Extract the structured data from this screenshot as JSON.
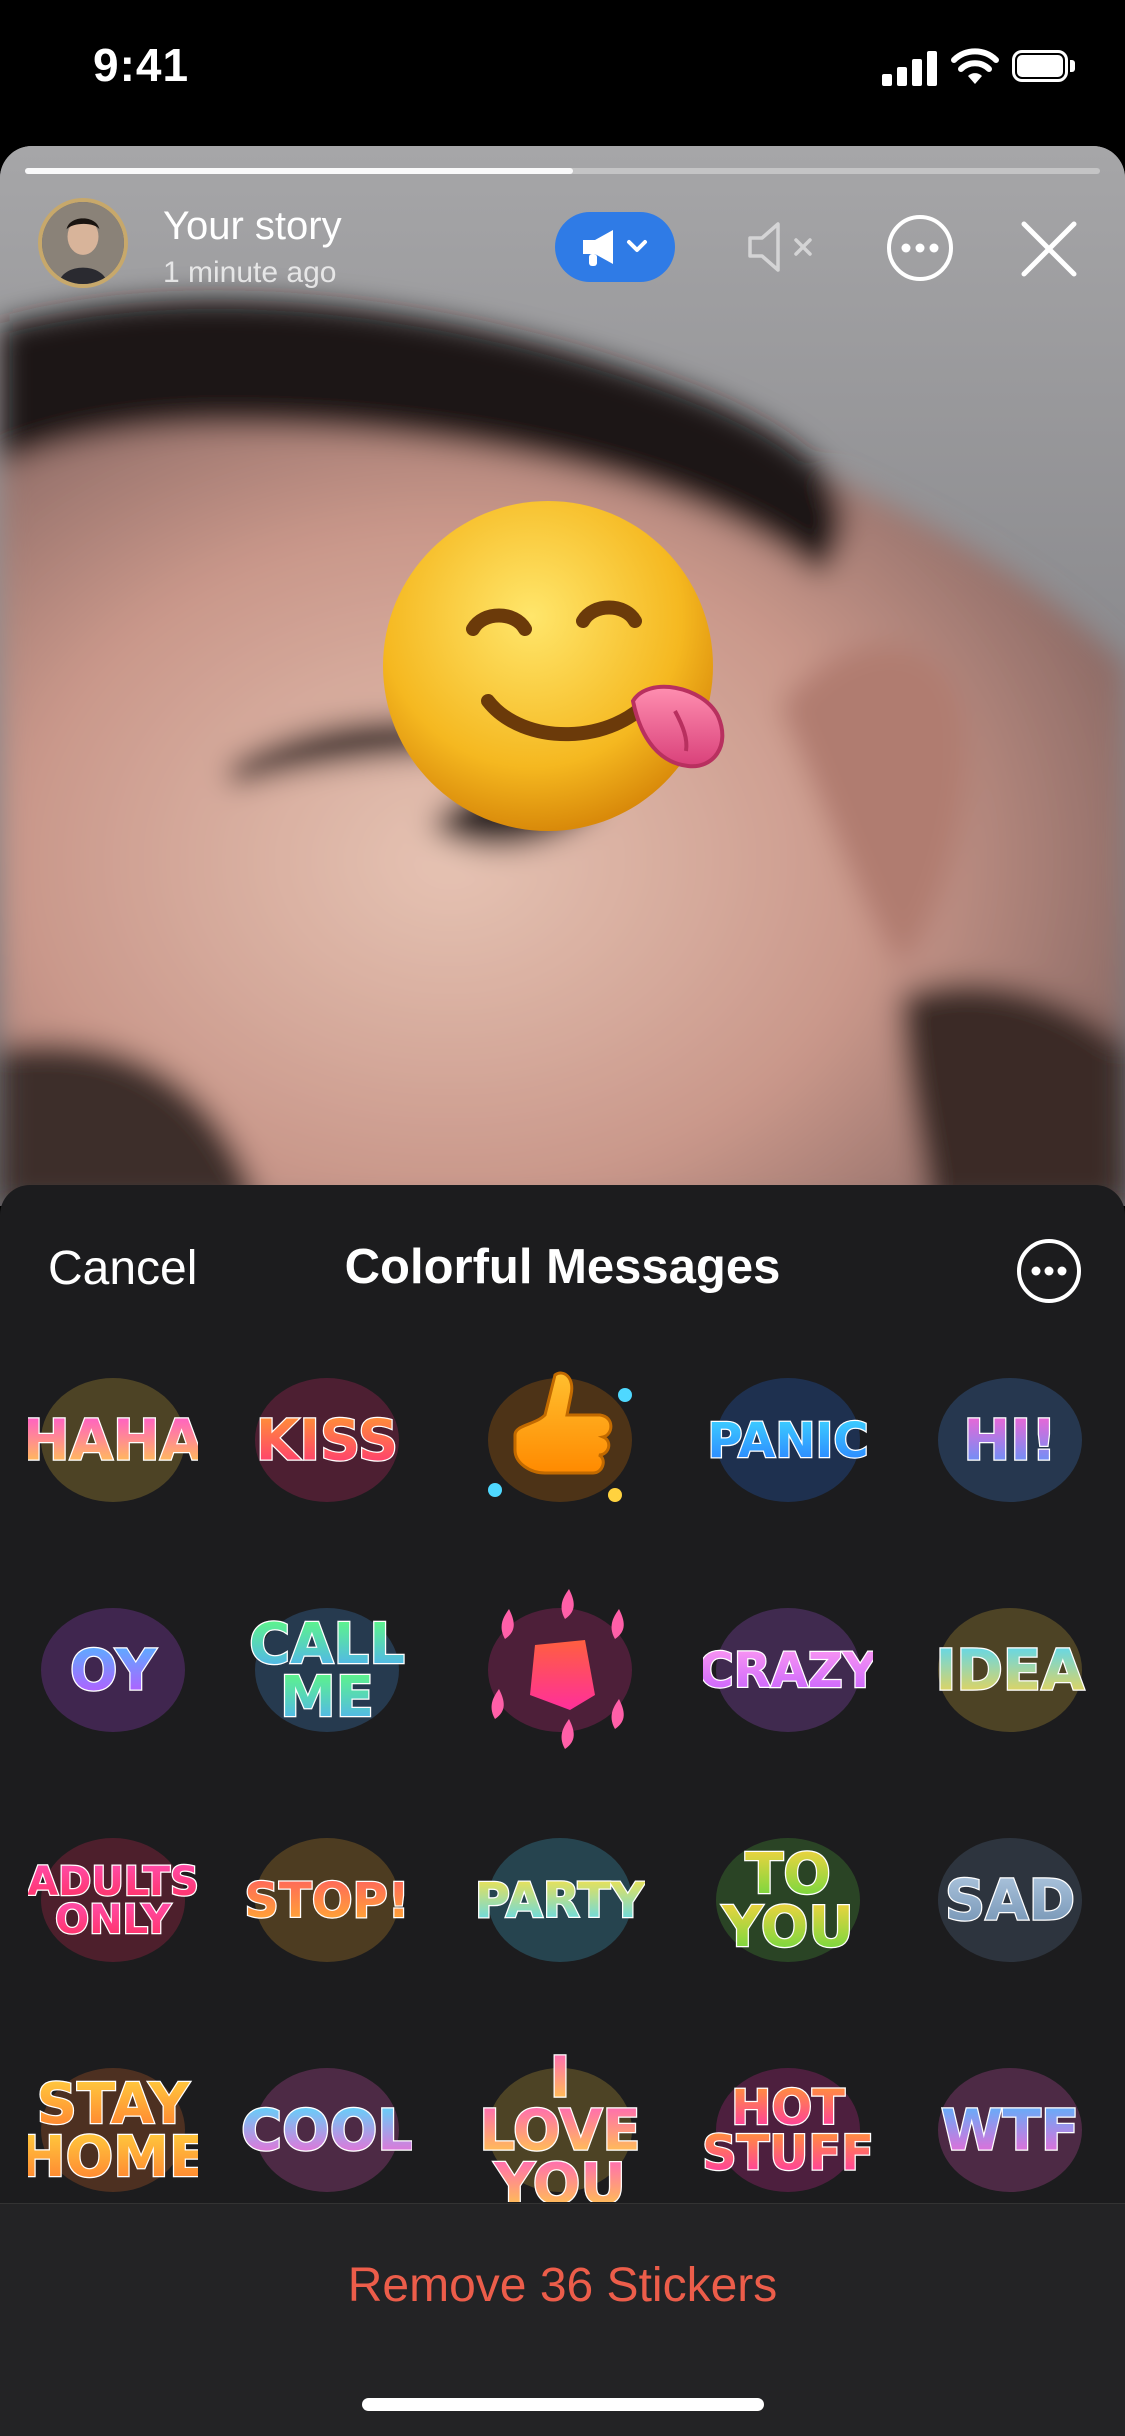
{
  "status_bar": {
    "time": "9:41"
  },
  "story": {
    "title": "Your story",
    "subtitle": "1 minute ago",
    "progress": 0.51,
    "sticker_emoji": "face-savoring-food"
  },
  "sheet": {
    "cancel_label": "Cancel",
    "title": "Colorful Messages",
    "more_icon": "ellipsis-circle-icon",
    "stickers": [
      {
        "text": "HAHA",
        "colors": [
          "#ff4fd8",
          "#ffd23f"
        ]
      },
      {
        "text": "KISS",
        "colors": [
          "#ff9b2f",
          "#ff2f7a"
        ]
      },
      {
        "text": "",
        "icon": "thumbs-up",
        "colors": [
          "#ffbf2f",
          "#ff8a00"
        ]
      },
      {
        "text": "PANIC",
        "colors": [
          "#3fd8ff",
          "#2a7cff"
        ]
      },
      {
        "text": "HI!",
        "colors": [
          "#ff5fd0",
          "#4f9bff"
        ]
      },
      {
        "text": "OY",
        "colors": [
          "#4fb8ff",
          "#c44fff"
        ]
      },
      {
        "text": "CALL ME",
        "colors": [
          "#5fff7a",
          "#4fa8ff"
        ]
      },
      {
        "text": "",
        "icon": "flame",
        "colors": [
          "#ff5f3f",
          "#ff2f9b"
        ]
      },
      {
        "text": "CRAZY",
        "colors": [
          "#ff9bf0",
          "#c45fff"
        ]
      },
      {
        "text": "IDEA",
        "colors": [
          "#4fd8ff",
          "#ffd23f"
        ]
      },
      {
        "text": "ADULTS ONLY",
        "colors": [
          "#ff4fb0",
          "#ff2f5f"
        ]
      },
      {
        "text": "STOP!",
        "colors": [
          "#ff5f5f",
          "#ffb02f"
        ]
      },
      {
        "text": "PARTY",
        "colors": [
          "#ffe23f",
          "#4fd8ff"
        ]
      },
      {
        "text": "TO YOU",
        "colors": [
          "#ffd23f",
          "#5fd83f"
        ]
      },
      {
        "text": "SAD",
        "colors": [
          "#b0c8e0",
          "#6f8fb0"
        ]
      },
      {
        "text": "STAY HOME",
        "colors": [
          "#ffd23f",
          "#ff7a2f"
        ]
      },
      {
        "text": "COOL",
        "colors": [
          "#4fe0ff",
          "#ff5fd0"
        ]
      },
      {
        "text": "I LOVE YOU",
        "colors": [
          "#ff5fc0",
          "#ffd23f"
        ]
      },
      {
        "text": "HOT STUFF",
        "colors": [
          "#ff9b2f",
          "#ff2fb0"
        ]
      },
      {
        "text": "WTF",
        "colors": [
          "#4fb8ff",
          "#ff5fd0"
        ]
      }
    ],
    "remove_label": "Remove 36 Stickers"
  }
}
